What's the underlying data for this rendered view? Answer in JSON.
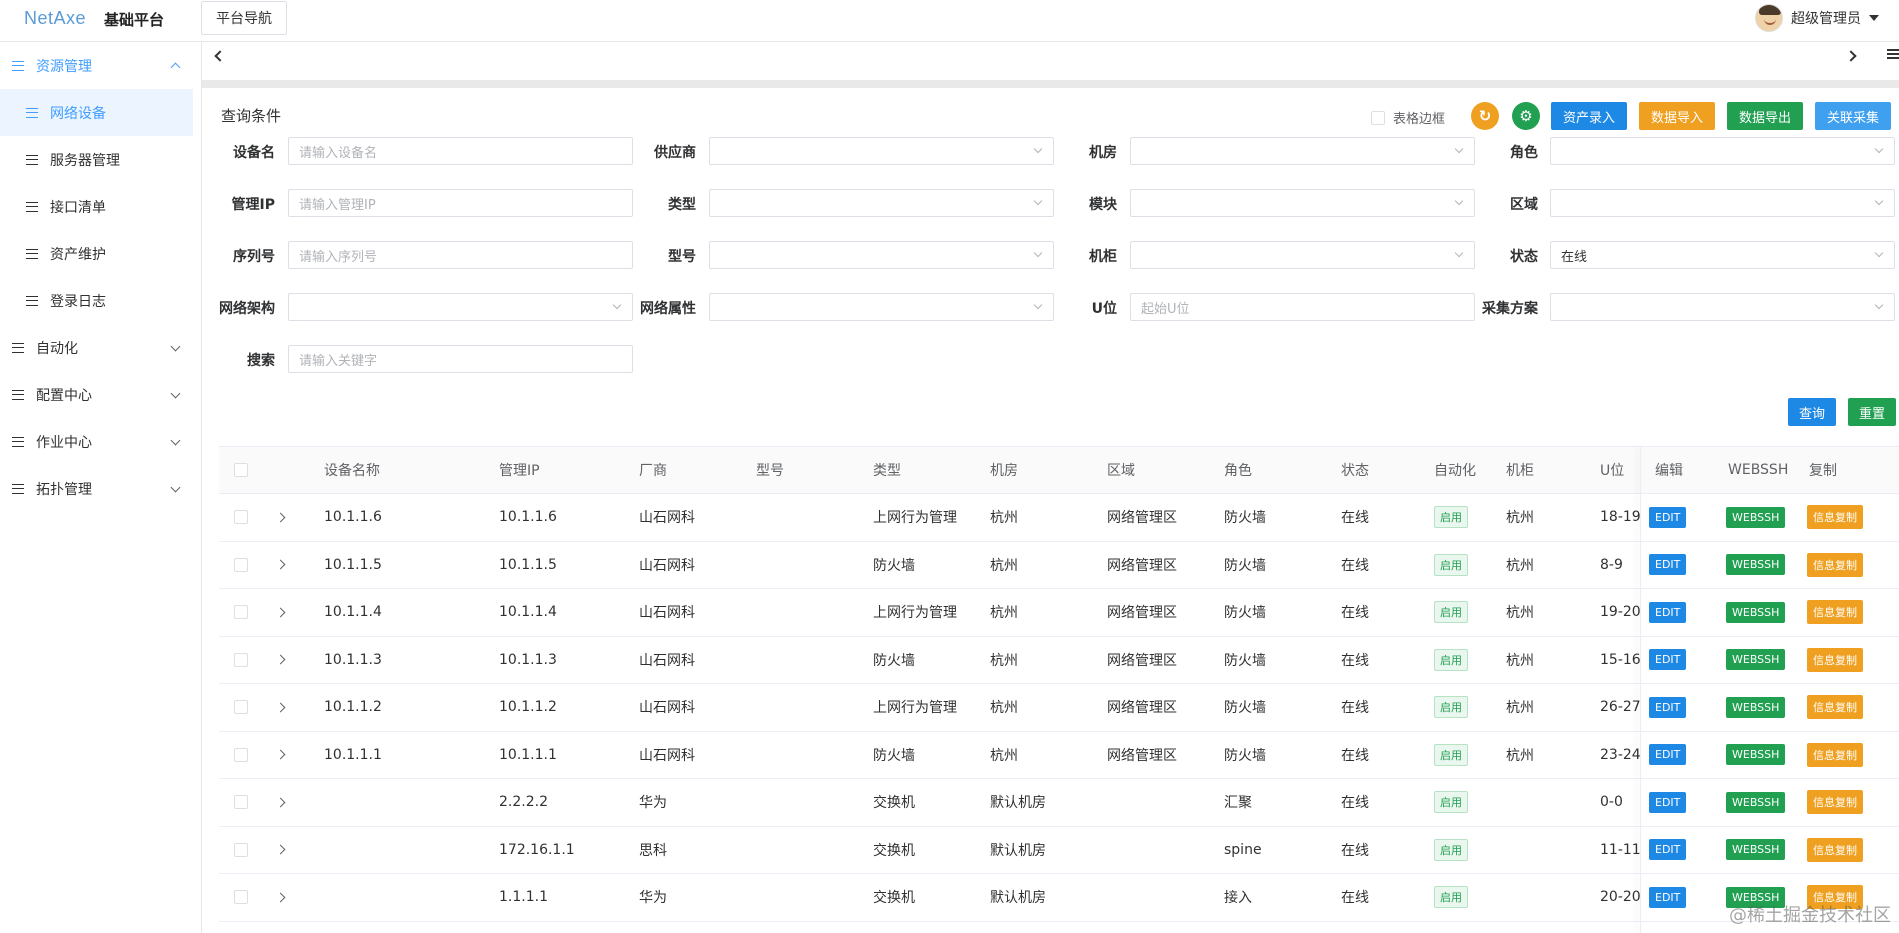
{
  "header": {
    "logo": "NetAxe",
    "brand_title": "基础平台",
    "platform_nav": "平台导航",
    "user": "超级管理员"
  },
  "sidebar": {
    "groups": [
      {
        "label": "资源管理",
        "expanded": true
      },
      {
        "label": "自动化"
      },
      {
        "label": "配置中心"
      },
      {
        "label": "作业中心"
      },
      {
        "label": "拓扑管理"
      }
    ],
    "sub_items": [
      "网络设备",
      "服务器管理",
      "接口清单",
      "资产维护",
      "登录日志"
    ]
  },
  "query": {
    "title": "查询条件",
    "table_border": "表格边框",
    "actions": {
      "asset_entry": "资产录入",
      "data_import": "数据导入",
      "data_export": "数据导出",
      "assoc_collect": "关联采集",
      "search": "查询",
      "reset": "重置"
    },
    "fields": {
      "device_name": {
        "label": "设备名",
        "placeholder": "请输入设备名"
      },
      "vendor": {
        "label": "供应商"
      },
      "room": {
        "label": "机房"
      },
      "role": {
        "label": "角色"
      },
      "mgmt_ip": {
        "label": "管理IP",
        "placeholder": "请输入管理IP"
      },
      "type": {
        "label": "类型"
      },
      "module": {
        "label": "模块"
      },
      "area": {
        "label": "区域"
      },
      "serial": {
        "label": "序列号",
        "placeholder": "请输入序列号"
      },
      "model": {
        "label": "型号"
      },
      "rack": {
        "label": "机柜"
      },
      "status": {
        "label": "状态",
        "value": "在线"
      },
      "net_arch": {
        "label": "网络架构"
      },
      "net_attr": {
        "label": "网络属性"
      },
      "u_pos": {
        "label": "U位",
        "placeholder": "起始U位"
      },
      "collect_plan": {
        "label": "采集方案"
      },
      "keyword": {
        "label": "搜索",
        "placeholder": "请输入关键字"
      }
    }
  },
  "table": {
    "columns": [
      "设备名称",
      "管理IP",
      "厂商",
      "型号",
      "类型",
      "机房",
      "区域",
      "角色",
      "状态",
      "自动化",
      "机柜",
      "U位",
      "编辑",
      "WEBSSH",
      "复制"
    ],
    "row_buttons": {
      "edit": "EDIT",
      "webssh": "WEBSSH",
      "copy": "信息复制"
    },
    "rows": [
      {
        "name": "10.1.1.6",
        "ip": "10.1.1.6",
        "vendor": "山石网科",
        "model": "",
        "type": "上网行为管理",
        "room": "杭州",
        "area": "网络管理区",
        "role": "防火墙",
        "status": "在线",
        "auto": "启用",
        "rack": "杭州",
        "u": "18-19"
      },
      {
        "name": "10.1.1.5",
        "ip": "10.1.1.5",
        "vendor": "山石网科",
        "model": "",
        "type": "防火墙",
        "room": "杭州",
        "area": "网络管理区",
        "role": "防火墙",
        "status": "在线",
        "auto": "启用",
        "rack": "杭州",
        "u": "8-9"
      },
      {
        "name": "10.1.1.4",
        "ip": "10.1.1.4",
        "vendor": "山石网科",
        "model": "",
        "type": "上网行为管理",
        "room": "杭州",
        "area": "网络管理区",
        "role": "防火墙",
        "status": "在线",
        "auto": "启用",
        "rack": "杭州",
        "u": "19-20"
      },
      {
        "name": "10.1.1.3",
        "ip": "10.1.1.3",
        "vendor": "山石网科",
        "model": "",
        "type": "防火墙",
        "room": "杭州",
        "area": "网络管理区",
        "role": "防火墙",
        "status": "在线",
        "auto": "启用",
        "rack": "杭州",
        "u": "15-16"
      },
      {
        "name": "10.1.1.2",
        "ip": "10.1.1.2",
        "vendor": "山石网科",
        "model": "",
        "type": "上网行为管理",
        "room": "杭州",
        "area": "网络管理区",
        "role": "防火墙",
        "status": "在线",
        "auto": "启用",
        "rack": "杭州",
        "u": "26-27"
      },
      {
        "name": "10.1.1.1",
        "ip": "10.1.1.1",
        "vendor": "山石网科",
        "model": "",
        "type": "防火墙",
        "room": "杭州",
        "area": "网络管理区",
        "role": "防火墙",
        "status": "在线",
        "auto": "启用",
        "rack": "杭州",
        "u": "23-24"
      },
      {
        "name": "",
        "ip": "2.2.2.2",
        "vendor": "华为",
        "model": "",
        "type": "交换机",
        "room": "默认机房",
        "area": "",
        "role": "汇聚",
        "status": "在线",
        "auto": "启用",
        "rack": "",
        "u": "0-0"
      },
      {
        "name": "",
        "ip": "172.16.1.1",
        "vendor": "思科",
        "model": "",
        "type": "交换机",
        "room": "默认机房",
        "area": "",
        "role": "spine",
        "status": "在线",
        "auto": "启用",
        "rack": "",
        "u": "11-11"
      },
      {
        "name": "",
        "ip": "1.1.1.1",
        "vendor": "华为",
        "model": "",
        "type": "交换机",
        "room": "默认机房",
        "area": "",
        "role": "接入",
        "status": "在线",
        "auto": "启用",
        "rack": "",
        "u": "20-20"
      }
    ]
  },
  "watermark": "@稀土掘金技术社区"
}
